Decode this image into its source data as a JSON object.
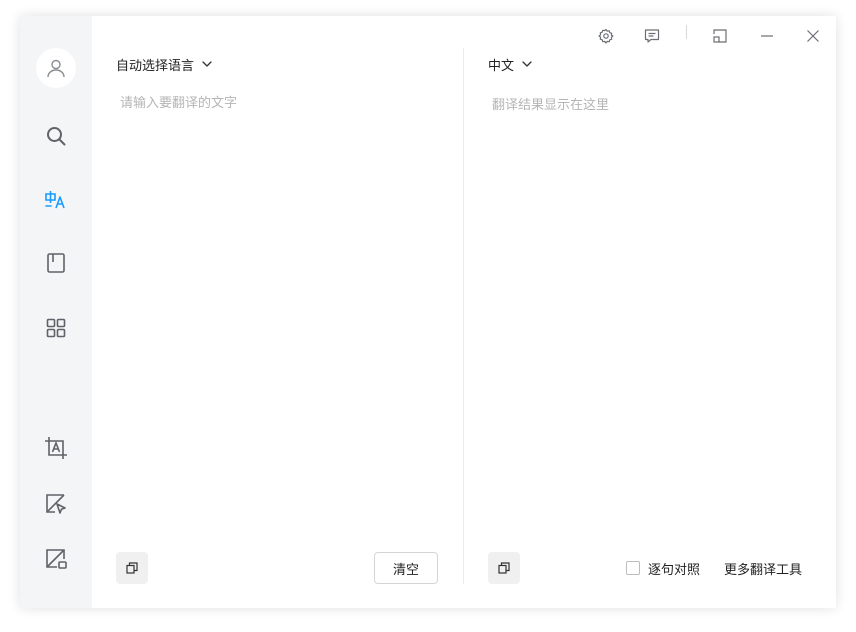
{
  "sidebar": {
    "items": [
      {
        "name": "search",
        "icon": "search-icon"
      },
      {
        "name": "translate",
        "icon": "translate-icon",
        "active": true
      },
      {
        "name": "book",
        "icon": "book-icon"
      },
      {
        "name": "apps",
        "icon": "grid-icon"
      },
      {
        "name": "screenshot-translate",
        "icon": "crop-text-icon"
      },
      {
        "name": "pointer-translate",
        "icon": "pointer-translate-icon"
      },
      {
        "name": "image-translate",
        "icon": "image-translate-icon"
      }
    ]
  },
  "colors": {
    "accent": "#1a9bff",
    "icon": "#5f6268",
    "sidebar_bg": "#f4f5f6"
  },
  "source": {
    "language": "自动选择语言",
    "placeholder": "请输入要翻译的文字",
    "clear_label": "清空"
  },
  "target": {
    "language": "中文",
    "placeholder": "翻译结果显示在这里",
    "sentence_align_label": "逐句对照",
    "more_tools_label": "更多翻译工具"
  }
}
